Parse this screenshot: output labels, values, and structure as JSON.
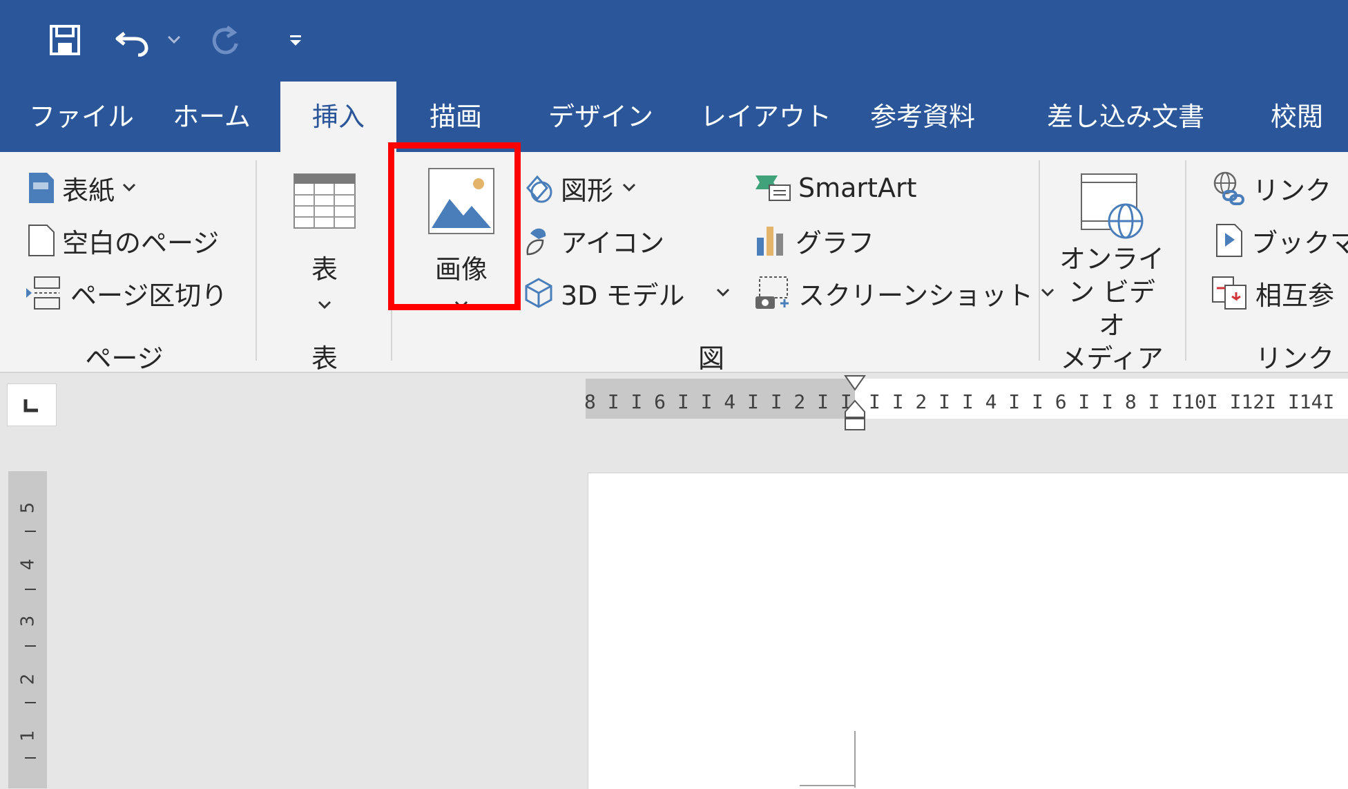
{
  "qat": {
    "save_icon": "save-icon",
    "undo_icon": "undo-icon",
    "redo_icon": "redo-icon",
    "customize_icon": "customize-icon"
  },
  "tabs": [
    {
      "label": "ファイル"
    },
    {
      "label": "ホーム"
    },
    {
      "label": "挿入"
    },
    {
      "label": "描画"
    },
    {
      "label": "デザイン"
    },
    {
      "label": "レイアウト"
    },
    {
      "label": "参考資料"
    },
    {
      "label": "差し込み文書"
    },
    {
      "label": "校閲"
    }
  ],
  "ribbon": {
    "pages": {
      "cover": "表紙",
      "blank": "空白のページ",
      "break": "ページ区切り",
      "label": "ページ"
    },
    "table": {
      "button": "表",
      "label": "表"
    },
    "illustrations": {
      "picture": "画像",
      "shapes": "図形",
      "icons": "アイコン",
      "models": "3D モデル",
      "smartart": "SmartArt",
      "chart": "グラフ",
      "screenshot": "スクリーンショット",
      "label": "図"
    },
    "media": {
      "video_line1": "オンライ",
      "video_line2": "ン ビデオ",
      "label": "メディア"
    },
    "links": {
      "link": "リンク",
      "bookmark": "ブックマー",
      "crossref": "相互参",
      "label": "リンク"
    }
  },
  "ruler": {
    "left_ticks": "8 I   I 6 I   I 4 I   I 2 I   I",
    "right_ticks": "I   I 2 I   I 4 I   I 6 I   I 8 I   I10I   I12I   I14I",
    "vertical": [
      "5",
      "4",
      "3",
      "2",
      "1"
    ]
  },
  "colors": {
    "title_blue": "#2b579a",
    "ribbon_bg": "#f3f3f3",
    "highlight": "#ff0000"
  }
}
